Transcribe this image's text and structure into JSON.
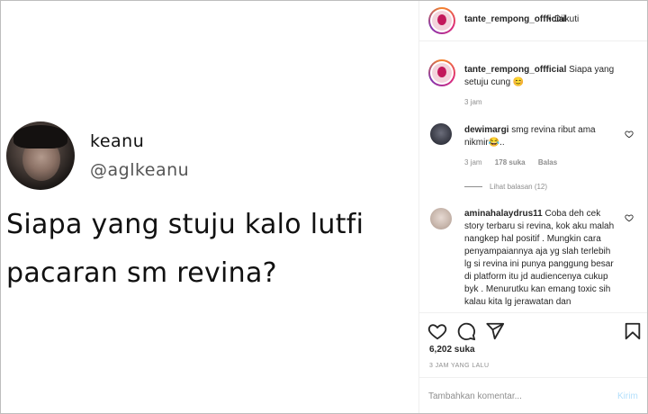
{
  "post": {
    "tweet": {
      "name": "keanu",
      "handle": "@aglkeanu",
      "text": "Siapa yang stuju kalo lutfi pacaran sm revina?"
    }
  },
  "header": {
    "username": "tante_rempong_offficial",
    "separator": "•",
    "follow_label": "Diikuti"
  },
  "caption": {
    "username": "tante_rempong_offficial",
    "text": "Siapa yang setuju cung 😊",
    "time": "3 jam"
  },
  "comments": [
    {
      "username": "dewimargi",
      "text": "smg revina ribut ama nikmir😂..",
      "time": "3 jam",
      "likes": "178 suka",
      "reply": "Balas",
      "view_replies": "Lihat balasan (12)"
    },
    {
      "username": "aminahalaydrus11",
      "text": "Coba deh cek story terbaru si revina, kok aku malah nangkep hal positif . Mungkin cara penyampaiannya aja yg slah terlebih lg si revina ini punya panggung besar di platform itu jd audiencenya cukup byk . Menurutku kan emang toxic sih kalau kita lg jerawatan dan"
    }
  ],
  "actions": {
    "like_icon": "heart-icon",
    "comment_icon": "comment-bubble-icon",
    "share_icon": "paper-plane-icon",
    "save_icon": "bookmark-icon"
  },
  "stats": {
    "likes": "6,202 suka",
    "time_ago": "3 JAM YANG LALU"
  },
  "comment_box": {
    "placeholder": "Tambahkan komentar...",
    "post_label": "Kirim"
  }
}
